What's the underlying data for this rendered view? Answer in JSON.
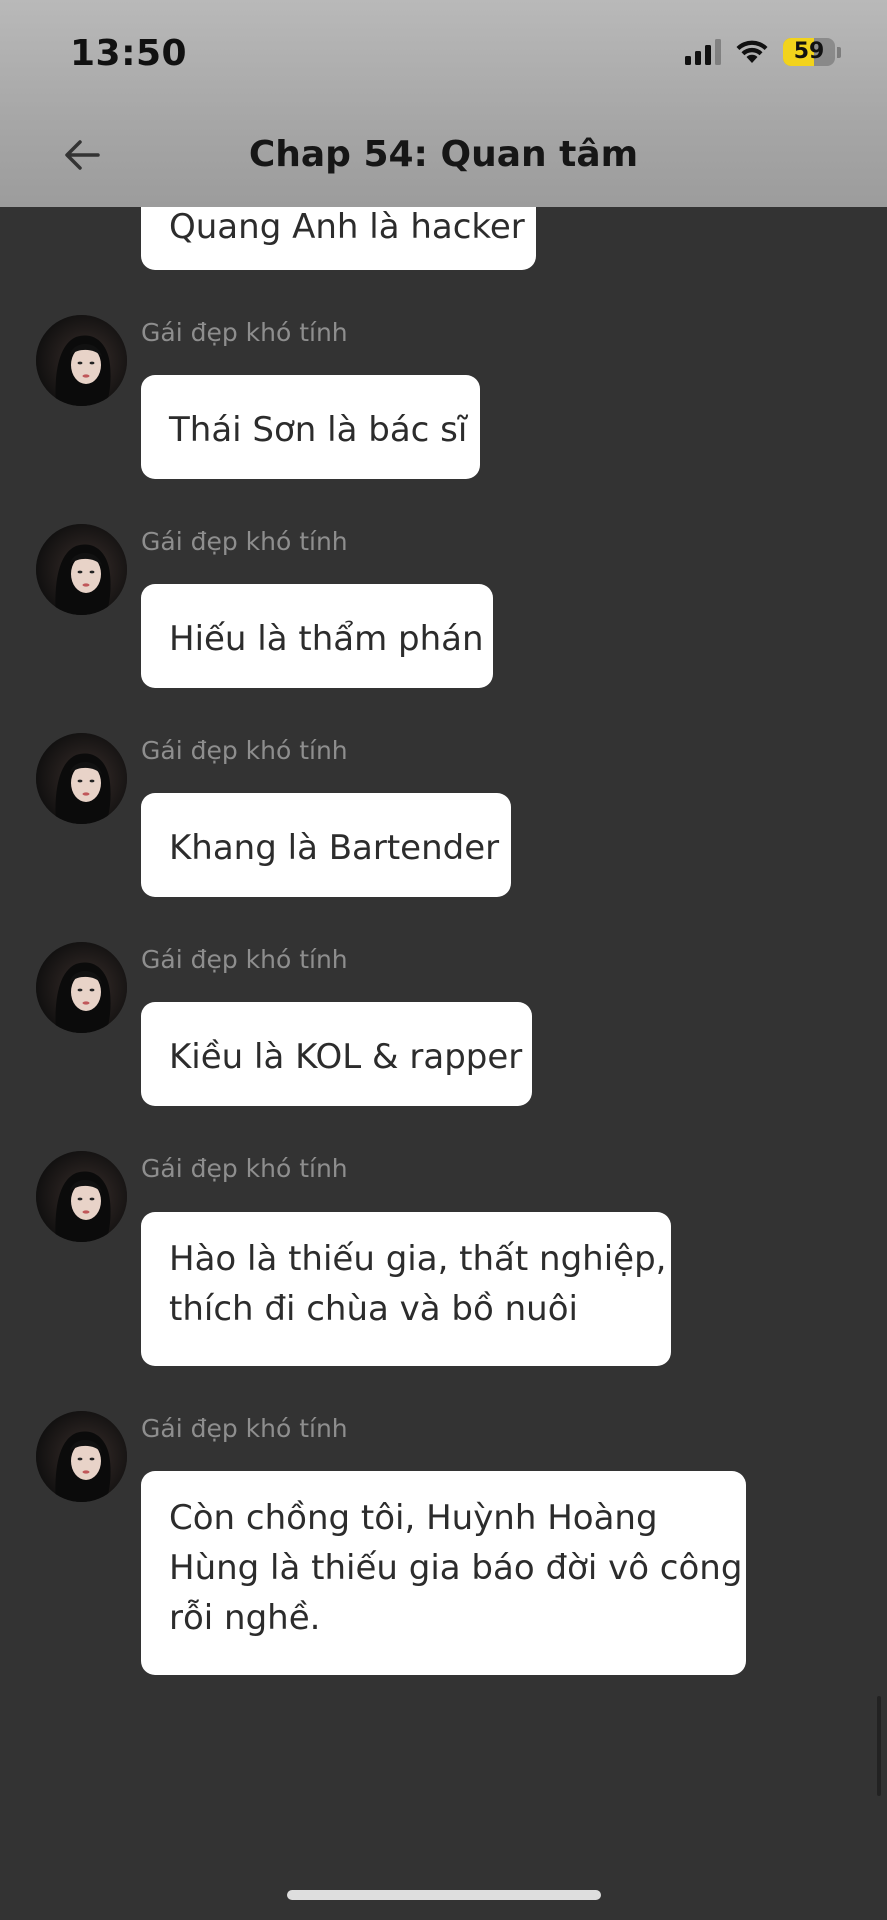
{
  "status_bar": {
    "time": "13:50",
    "battery": "59",
    "battery_level_percent": 59
  },
  "header": {
    "title": "Chap 54: Quan tâm",
    "back_icon": "arrow-left-icon"
  },
  "chat": {
    "partial_message": "Quang Anh là hacker",
    "messages": [
      {
        "sender": "Gái đẹp khó tính",
        "lines": [
          "Thái Sơn là bác sĩ"
        ]
      },
      {
        "sender": "Gái đẹp khó tính",
        "lines": [
          "Hiếu là thẩm phán"
        ]
      },
      {
        "sender": "Gái đẹp khó tính",
        "lines": [
          "Khang là Bartender"
        ]
      },
      {
        "sender": "Gái đẹp khó tính",
        "lines": [
          "Kiều là KOL & rapper"
        ]
      },
      {
        "sender": "Gái đẹp khó tính",
        "lines": [
          "Hào là thiếu gia, thất nghiệp,",
          "thích đi chùa và bồ nuôi"
        ]
      },
      {
        "sender": "Gái đẹp khó tính",
        "lines": [
          "Còn chồng tôi, Huỳnh Hoàng",
          "Hùng là thiếu gia báo đời vô công",
          "rỗi nghề."
        ]
      }
    ]
  },
  "colors": {
    "background": "#333333",
    "bubble": "#ffffff",
    "header": "#a9a9a9",
    "battery": "#f2d31c"
  }
}
